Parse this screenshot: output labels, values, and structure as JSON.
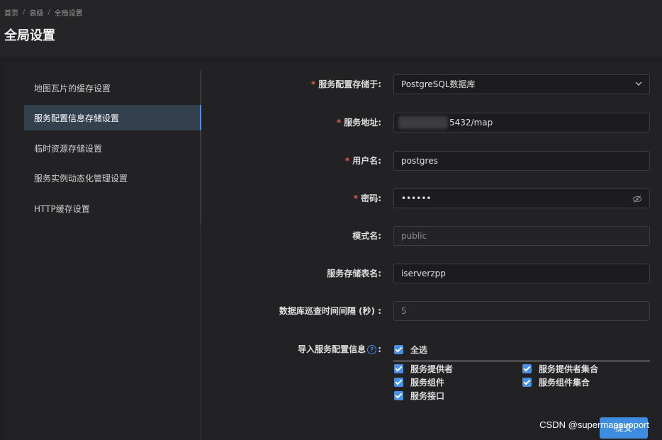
{
  "breadcrumb": [
    "首页",
    "高级",
    "全局设置"
  ],
  "breadcrumb_sep": "/",
  "page_title": "全局设置",
  "sidebar": {
    "items": [
      {
        "label": "地图瓦片的缓存设置",
        "active": false
      },
      {
        "label": "服务配置信息存储设置",
        "active": true
      },
      {
        "label": "临时资源存储设置",
        "active": false
      },
      {
        "label": "服务实例动态化管理设置",
        "active": false
      },
      {
        "label": "HTTP缓存设置",
        "active": false
      }
    ]
  },
  "form": {
    "storage": {
      "label": "服务配置存储于:",
      "value": "PostgreSQL数据库",
      "required": true
    },
    "address": {
      "label": "服务地址:",
      "value": "5432/map",
      "required": true
    },
    "username": {
      "label": "用户名:",
      "value": "postgres",
      "required": true
    },
    "password": {
      "label": "密码:",
      "value": "••••••",
      "required": true
    },
    "schema": {
      "label": "模式名:",
      "value": "public"
    },
    "table": {
      "label": "服务存储表名:",
      "value": "iserverzpp"
    },
    "interval": {
      "label": "数据库巡查时间间隔 (秒) :",
      "value": "5"
    },
    "import": {
      "label": "导入服务配置信息",
      "label_suffix": ":",
      "help_icon": "?",
      "select_all": "全选",
      "options": [
        "服务提供者",
        "服务提供者集合",
        "服务组件",
        "服务组件集合",
        "服务接口"
      ]
    }
  },
  "required_mark": "*",
  "submit_label": "提交",
  "watermark": "CSDN @supermapsupport",
  "colors": {
    "accent": "#4a90e2",
    "required": "#e25b4b",
    "active_nav": "#33414f"
  }
}
